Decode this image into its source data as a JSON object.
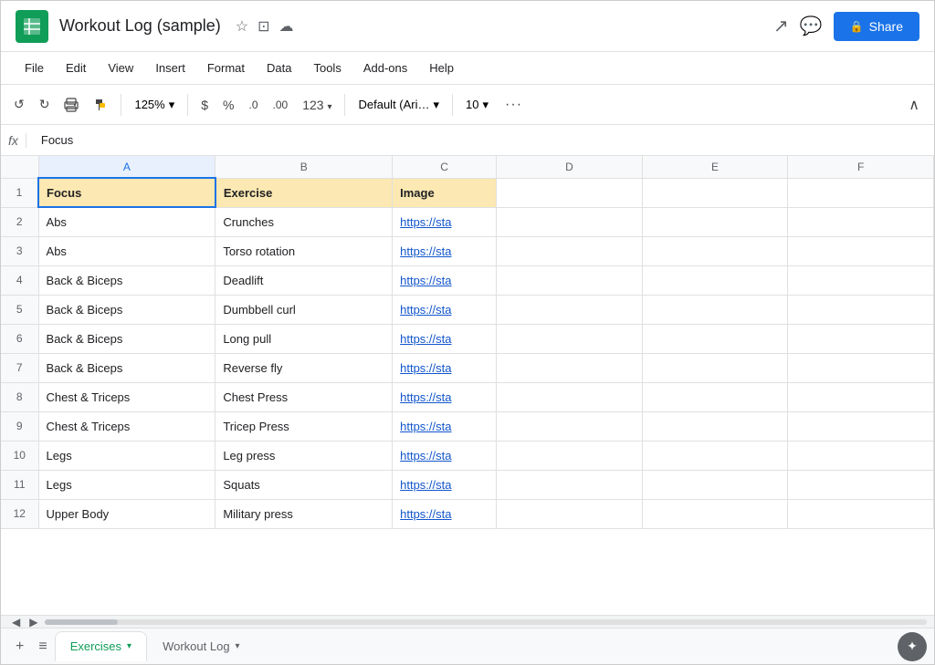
{
  "app": {
    "icon": "≡",
    "title": "Workout Log (sample)",
    "share_label": "Share"
  },
  "menu": {
    "items": [
      "File",
      "Edit",
      "View",
      "Insert",
      "Format",
      "Data",
      "Tools",
      "Add-ons",
      "Help"
    ]
  },
  "toolbar": {
    "zoom": "125%",
    "currency": "$",
    "percent": "%",
    "decimal_decrease": ".0",
    "decimal_increase": ".00",
    "format_number": "123",
    "font": "Default (Ari…",
    "font_size": "10",
    "more": "···",
    "undo_icon": "↺",
    "redo_icon": "↻",
    "print_icon": "🖨",
    "paint_icon": "🖌"
  },
  "formula_bar": {
    "fx": "fx",
    "content": "Focus"
  },
  "columns": {
    "row_num": "",
    "A": "A",
    "B": "B",
    "C": "C",
    "D": "D",
    "E": "E",
    "F": "F"
  },
  "rows": [
    {
      "row": "1",
      "A": "Focus",
      "B": "Exercise",
      "C": "Image",
      "D": "",
      "E": "",
      "F": "",
      "a_type": "header",
      "b_type": "header",
      "c_type": "header"
    },
    {
      "row": "2",
      "A": "Abs",
      "B": "Crunches",
      "C": "https://sta",
      "D": "",
      "E": "",
      "F": "",
      "c_type": "link"
    },
    {
      "row": "3",
      "A": "Abs",
      "B": "Torso rotation",
      "C": "https://sta",
      "D": "",
      "E": "",
      "F": "",
      "c_type": "link"
    },
    {
      "row": "4",
      "A": "Back & Biceps",
      "B": "Deadlift",
      "C": "https://sta",
      "D": "",
      "E": "",
      "F": "",
      "c_type": "link"
    },
    {
      "row": "5",
      "A": "Back & Biceps",
      "B": "Dumbbell curl",
      "C": "https://sta",
      "D": "",
      "E": "",
      "F": "",
      "c_type": "link"
    },
    {
      "row": "6",
      "A": "Back & Biceps",
      "B": "Long pull",
      "C": "https://sta",
      "D": "",
      "E": "",
      "F": "",
      "c_type": "link"
    },
    {
      "row": "7",
      "A": "Back & Biceps",
      "B": "Reverse fly",
      "C": "https://sta",
      "D": "",
      "E": "",
      "F": "",
      "c_type": "link"
    },
    {
      "row": "8",
      "A": "Chest & Triceps",
      "B": "Chest Press",
      "C": "https://sta",
      "D": "",
      "E": "",
      "F": "",
      "c_type": "link"
    },
    {
      "row": "9",
      "A": "Chest & Triceps",
      "B": "Tricep Press",
      "C": "https://sta",
      "D": "",
      "E": "",
      "F": "",
      "c_type": "link"
    },
    {
      "row": "10",
      "A": "Legs",
      "B": "Leg press",
      "C": "https://sta",
      "D": "",
      "E": "",
      "F": "",
      "c_type": "link"
    },
    {
      "row": "11",
      "A": "Legs",
      "B": "Squats",
      "C": "https://sta",
      "D": "",
      "E": "",
      "F": "",
      "c_type": "link"
    },
    {
      "row": "12",
      "A": "Upper Body",
      "B": "Military press",
      "C": "https://sta",
      "D": "",
      "E": "",
      "F": "",
      "c_type": "link"
    }
  ],
  "tabs": [
    {
      "name": "Exercises",
      "active": true
    },
    {
      "name": "Workout Log",
      "active": false
    }
  ],
  "colors": {
    "header_bg": "#fce8b2",
    "selected_col": "#e8f0fe",
    "link": "#1155cc",
    "green": "#0f9d58",
    "share_blue": "#1a73e8"
  }
}
